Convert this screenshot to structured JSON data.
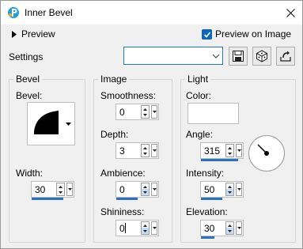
{
  "window": {
    "title": "Inner Bevel",
    "app_icon": "psp-logo-icon",
    "close_icon": "close-icon"
  },
  "top": {
    "preview_label": "Preview",
    "preview_on_image_label": "Preview on Image",
    "preview_on_image_checked": true,
    "settings_label": "Settings",
    "settings_value": "",
    "icons": [
      "save-icon",
      "random-dice-icon",
      "reset-icon"
    ]
  },
  "bevel_group": {
    "title": "Bevel",
    "bevel_label": "Bevel:",
    "width_label": "Width:",
    "width_value": "30",
    "width_level": 0.75
  },
  "image_group": {
    "title": "Image",
    "smoothness_label": "Smoothness:",
    "smoothness_value": "0",
    "depth_label": "Depth:",
    "depth_value": "3",
    "ambience_label": "Ambience:",
    "ambience_value": "0",
    "ambience_level": 0.5,
    "shininess_label": "Shininess:",
    "shininess_value": "0"
  },
  "light_group": {
    "title": "Light",
    "color_label": "Color:",
    "color_value": "#ffffff",
    "angle_label": "Angle:",
    "angle_value": "315",
    "angle_level": 0.88,
    "intensity_label": "Intensity:",
    "intensity_value": "50",
    "intensity_level": 0.5,
    "elevation_label": "Elevation:",
    "elevation_value": "30",
    "elevation_level": 0.33
  },
  "colors": {
    "accent": "#2d6fc0",
    "checkbox": "#0a66c2",
    "dropdown_border": "#1e78d0"
  }
}
